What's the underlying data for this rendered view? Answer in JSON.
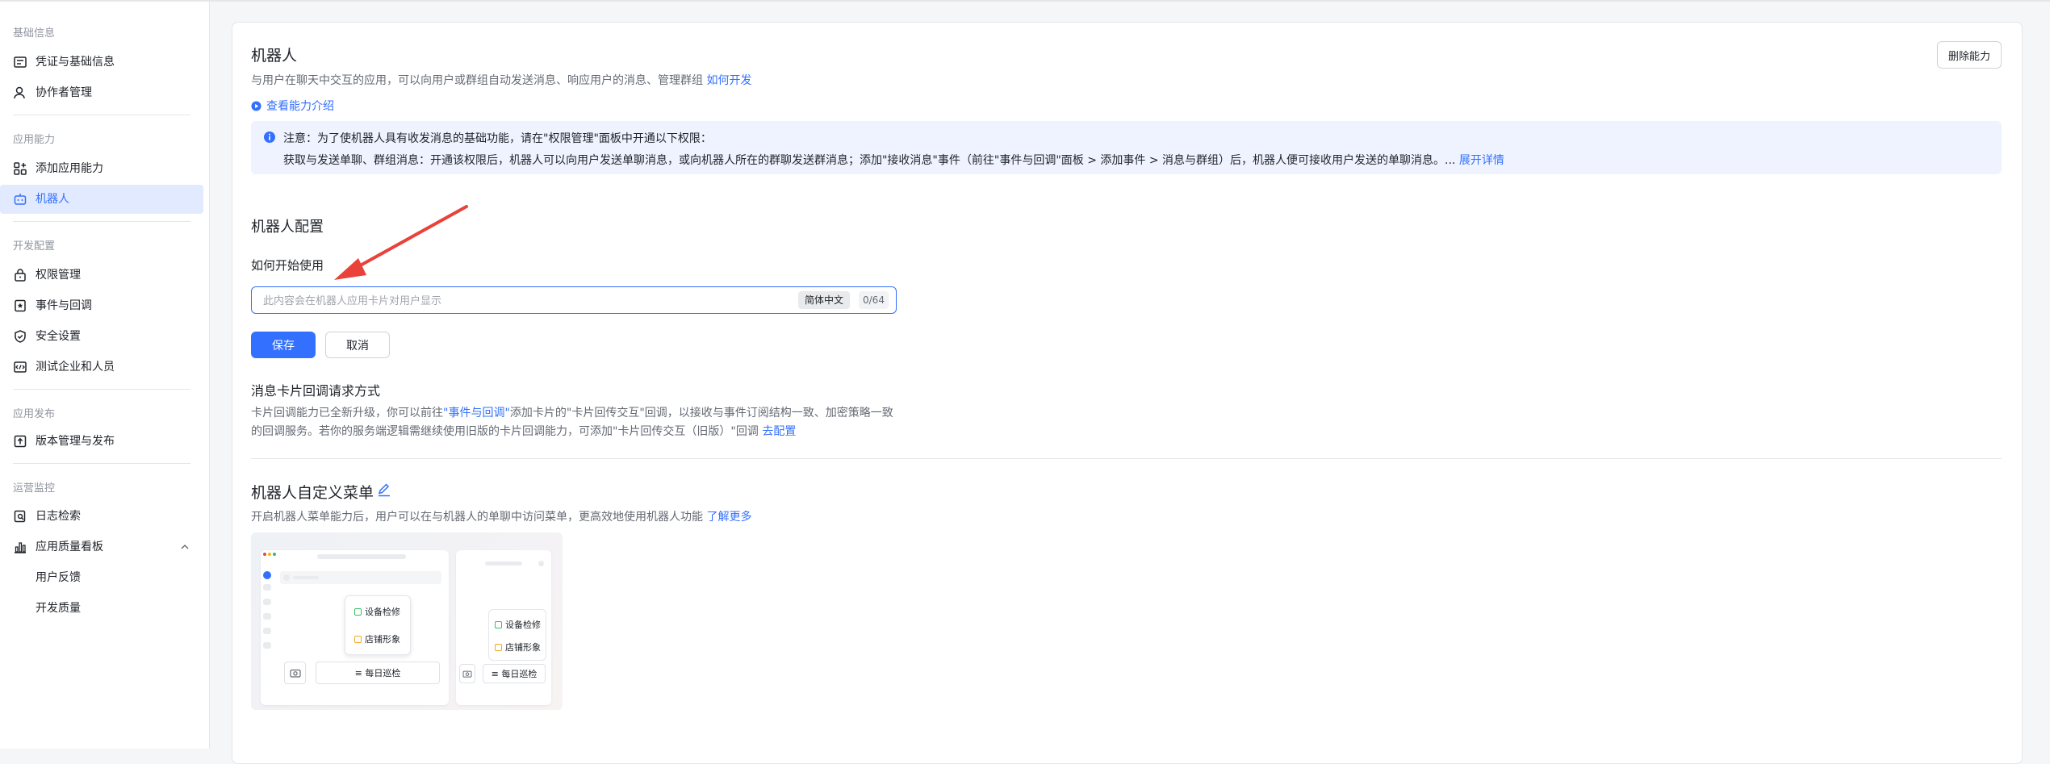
{
  "sidebar": {
    "sections": [
      {
        "title": "基础信息",
        "items": [
          {
            "label": "凭证与基础信息",
            "icon": "credential-icon"
          },
          {
            "label": "协作者管理",
            "icon": "user-icon"
          }
        ]
      },
      {
        "title": "应用能力",
        "items": [
          {
            "label": "添加应用能力",
            "icon": "add-grid-icon"
          },
          {
            "label": "机器人",
            "icon": "robot-icon",
            "active": true
          }
        ]
      },
      {
        "title": "开发配置",
        "items": [
          {
            "label": "权限管理",
            "icon": "lock-icon"
          },
          {
            "label": "事件与回调",
            "icon": "event-icon"
          },
          {
            "label": "安全设置",
            "icon": "shield-icon"
          },
          {
            "label": "测试企业和人员",
            "icon": "test-icon"
          }
        ]
      },
      {
        "title": "应用发布",
        "items": [
          {
            "label": "版本管理与发布",
            "icon": "upload-icon"
          }
        ]
      },
      {
        "title": "运营监控",
        "items": [
          {
            "label": "日志检索",
            "icon": "log-search-icon"
          },
          {
            "label": "应用质量看板",
            "icon": "chart-icon",
            "expanded": true
          },
          {
            "label": "用户反馈"
          },
          {
            "label": "开发质量"
          }
        ]
      }
    ]
  },
  "header": {
    "title": "机器人",
    "description": "与用户在聊天中交互的应用，可以向用户或群组自动发送消息、响应用户的消息、管理群组",
    "how_to_link": "如何开发",
    "delete_button": "删除能力",
    "intro_link": "查看能力介绍"
  },
  "notice": {
    "line1": "注意：为了使机器人具有收发消息的基础功能，请在\"权限管理\"面板中开通以下权限：",
    "line2": "获取与发送单聊、群组消息：开通该权限后，机器人可以向用户发送单聊消息，或向机器人所在的群聊发送群消息；添加\"接收消息\"事件（前往\"事件与回调\"面板 > 添加事件 > 消息与群组）后，机器人便可接收用户发送的单聊消息。...",
    "expand_link": "展开详情",
    "accent_color": "#3370ff",
    "background_color": "#eef3ff"
  },
  "config": {
    "title": "机器人配置",
    "field_label": "如何开始使用",
    "input_value": "",
    "input_placeholder": "此内容会在机器人应用卡片对用户显示",
    "language_tag": "简体中文",
    "counter": "0/64",
    "save_button": "保存",
    "cancel_button": "取消"
  },
  "card_callback": {
    "title": "消息卡片回调请求方式",
    "line1_prefix": "卡片回调能力已全新升级，你可以前往",
    "line1_link": "\"事件与回调\"",
    "line1_suffix": "添加卡片的\"卡片回传交互\"回调，以接收与事件订阅结构一致、加密策略一致",
    "line2_text": "的回调服务。若你的服务端逻辑需继续使用旧版的卡片回调能力，可添加\"卡片回传交互（旧版）\"回调",
    "line2_link": "去配置"
  },
  "custom_menu": {
    "title": "机器人自定义菜单",
    "description": "开启机器人菜单能力后，用户可以在与机器人的单聊中访问菜单，更高效地使用机器人功能",
    "learn_more": "了解更多",
    "preview": {
      "popup_items": [
        "设备检修",
        "店铺形象"
      ],
      "bottom_item": "每日巡检"
    }
  },
  "colors": {
    "primary": "#3370ff",
    "active_bg": "#e1eaff",
    "annotation_arrow": "#e8423a"
  }
}
